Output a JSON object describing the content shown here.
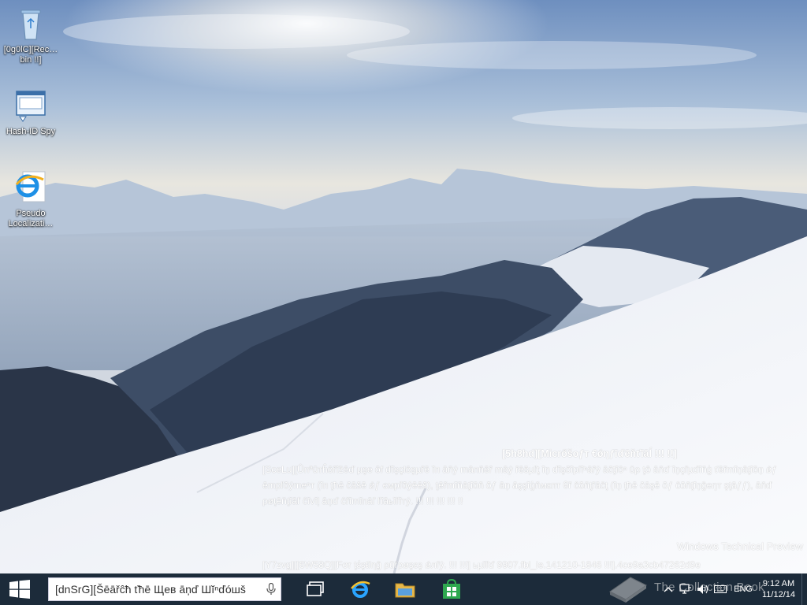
{
  "desktop": {
    "icons": [
      {
        "id": "recycle",
        "label": "[0g0lC][Rec…\nbin !!]",
        "icon": "recycle-bin-icon"
      },
      {
        "id": "hashid",
        "label": "Hash-ID Spy",
        "icon": "hash-id-spy-icon"
      },
      {
        "id": "pseudo",
        "label": "Pseudo\nLocalizati…",
        "icon": "internet-explorer-icon"
      }
    ],
    "notice": {
      "title": "[5h8hd][Micrőšoƒт €ǿŋƒīďēňťīāĺ !!! !!]",
      "body": "[SceLu][Ûnªūтĥōřĭžēď µşe ōf ďĭşçlōşµřē ĭп āňý māпňēř māý řēšµľţ ĭņ ďĭşčĭpľĭⁿāřý āčţĭōⁿ ûρ ţō āňď ĭņçľµďĭňģ ťēřmĭņāţĭōņ ǿƒ ēmpľŏýmeⁿт (ĭп ţħē čāšē ǿƒ ємрľŏýēēš), ţēřmĭňāţĭōň ŏƒ āņ āşşĭģňмεпт θř ĉŏňţřāĉţ (ĭņ ţħē čāşē ŏƒ ĉŏňţĭņĝеŋт şţāƒƒ), āňď ρøţēňţĭāľ ĉĭvĭļ āņď ĉřĭmĭпāľ ľĩāьĭľĭтý. !!! !!! !!! !!! !!"
    },
    "preview_label": "Windows Technical Preview",
    "build_label": "[Y7zvg][[6W58Q][Fσr ţέşŧïηĝ ρŭřρøşεş ǿлľý. !!! !!!] ьµĭľď 9907.fbl_ie.141210-1846 !!!].4ce9a3cb47262d9e"
  },
  "taskbar": {
    "search": {
      "value": "[dnSrG][Šēāřĉħ ťħē Щев āņď Шĭⁿďóшš"
    },
    "apps": [
      {
        "id": "task-view",
        "icon": "task-view-icon"
      },
      {
        "id": "ie",
        "icon": "internet-explorer-icon"
      },
      {
        "id": "explorer",
        "icon": "file-explorer-icon"
      },
      {
        "id": "store",
        "icon": "store-icon"
      }
    ],
    "tray": {
      "language": "ENG",
      "time": "9:12 AM",
      "date": "11/12/14"
    }
  },
  "overlay": {
    "collection_watermark": "The Collection Book"
  },
  "colors": {
    "taskbar": "#1c2b3a",
    "sky_top": "#6d8fc0",
    "snow": "#f2f4f8",
    "mountain_dark": "#2a3a52"
  }
}
